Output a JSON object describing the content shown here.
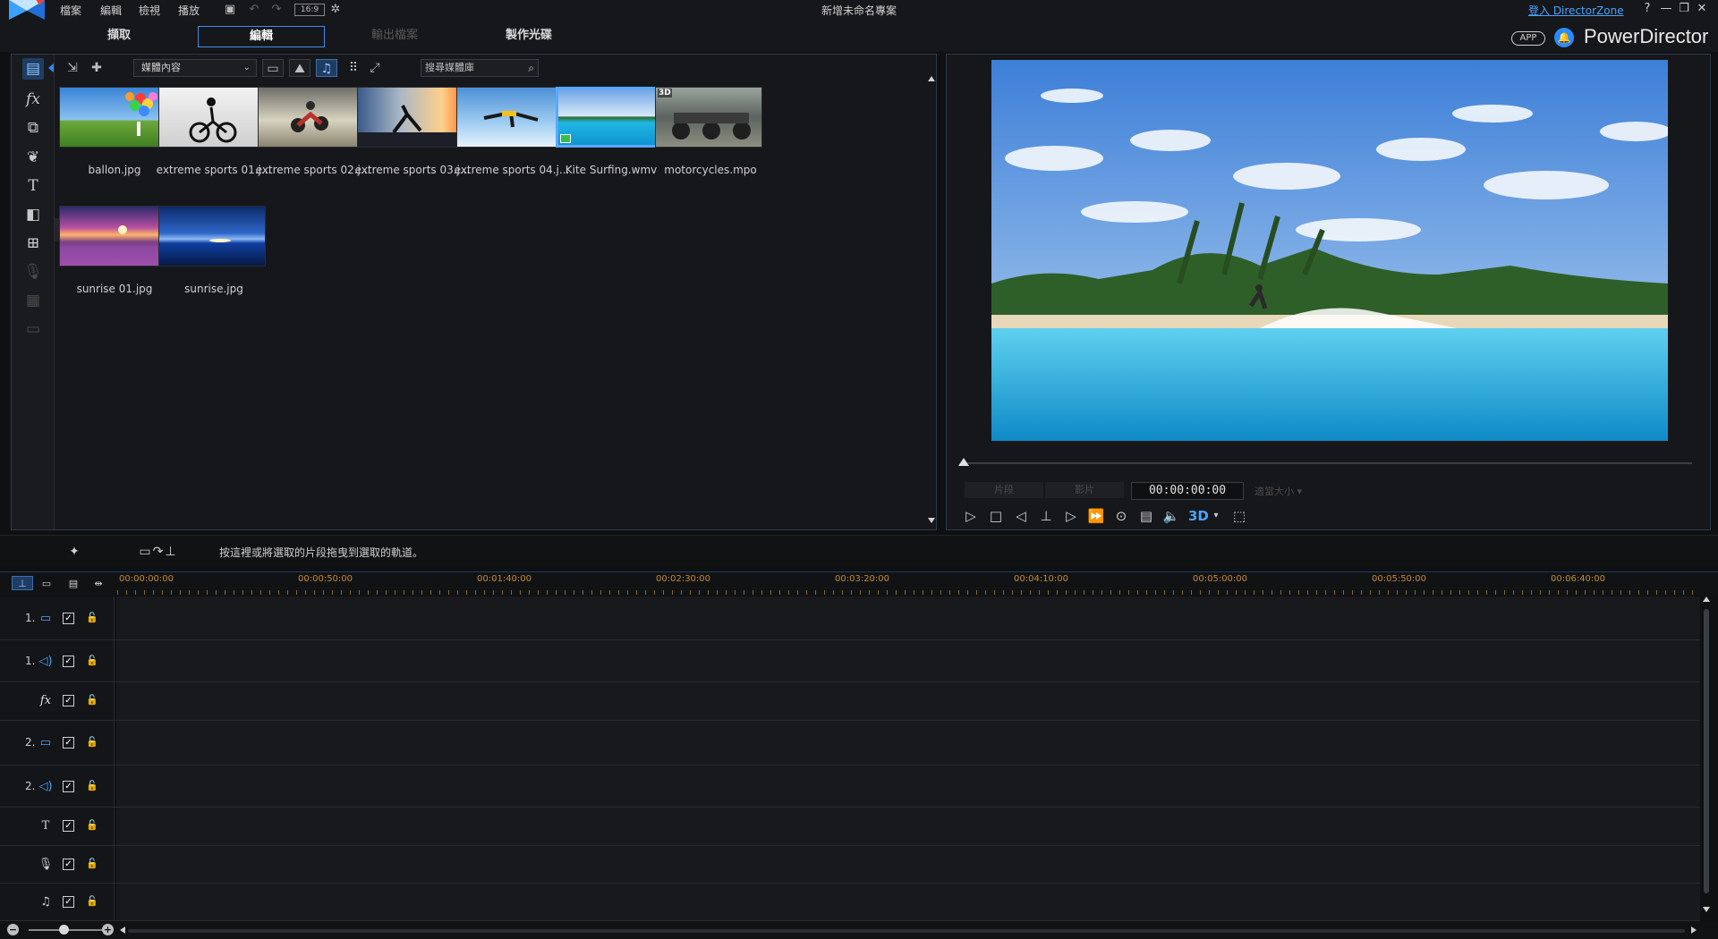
{
  "titlebar": {
    "menu": [
      "檔案",
      "編輯",
      "檢視",
      "播放"
    ],
    "aspect": "16:9",
    "project_title": "新增未命名專案",
    "directorzone_link": "登入 DirectorZone",
    "help": "?",
    "minimize": "—",
    "restore": "❐",
    "close": "✕"
  },
  "modes": {
    "capture": "擷取",
    "edit": "編輯",
    "produce": "輸出檔案",
    "disc": "製作光碟"
  },
  "brand": {
    "app_badge": "APP",
    "name": "PowerDirector"
  },
  "library": {
    "content_select": "媒體內容",
    "search_placeholder": "搜尋媒體庫",
    "items": [
      {
        "name": "ballon.jpg"
      },
      {
        "name": "extreme sports 01.j..."
      },
      {
        "name": "extreme sports 02.j..."
      },
      {
        "name": "extreme sports 03.j..."
      },
      {
        "name": "extreme sports 04.j..."
      },
      {
        "name": "Kite Surfing.wmv"
      },
      {
        "name": "motorcycles.mpo",
        "badge": "3D"
      },
      {
        "name": "sunrise 01.jpg"
      },
      {
        "name": "sunrise.jpg"
      }
    ]
  },
  "preview": {
    "clip_btn": "片段",
    "movie_btn": "影片",
    "timecode": "00:00:00:00",
    "zoom": "適當大小",
    "threeD": "3D"
  },
  "timeline": {
    "hint": "按這裡或將選取的片段拖曳到選取的軌道。",
    "ruler": [
      "00:00:00:00",
      "00:00:50:00",
      "00:01:40:00",
      "00:02:30:00",
      "00:03:20:00",
      "00:04:10:00",
      "00:05:00:00",
      "00:05:50:00",
      "00:06:40:00"
    ],
    "tracks": [
      {
        "num": "1.",
        "type": "video"
      },
      {
        "num": "1.",
        "type": "audio"
      },
      {
        "num": "",
        "type": "fx"
      },
      {
        "num": "2.",
        "type": "video"
      },
      {
        "num": "2.",
        "type": "audio"
      },
      {
        "num": "",
        "type": "title"
      },
      {
        "num": "",
        "type": "voice"
      },
      {
        "num": "",
        "type": "music"
      }
    ]
  },
  "colors": {
    "accent": "#3d8ee8",
    "ruler_text": "#c68a2b",
    "link": "#4aa3ff"
  }
}
